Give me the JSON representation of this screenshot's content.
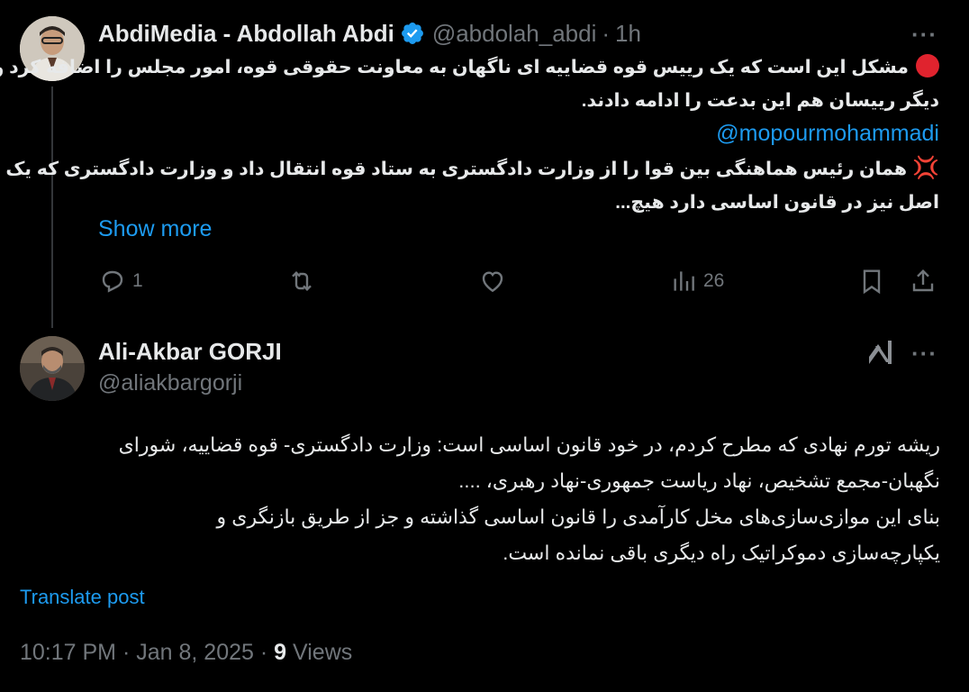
{
  "tweet1": {
    "display_name": "AbdiMedia - Abdollah Abdi",
    "handle": "@abdolah_abdi",
    "separator": "·",
    "time": "1h",
    "more_label": "···",
    "lines": [
      "مشکل این است که یک رییس قوه قضاییه ای ناگهان به معاونت حقوقی قوه، امور مجلس را اضافه کرد و",
      "دیگر رییسان هم این بدعت را ادامه دادند.",
      "همان رئیس هماهنگی بین قوا را از وزارت دادگستری به ستاد قوه انتقال داد و وزارت دادگستری که یک",
      "اصل نیز در قانون اساسی دارد هیچ..."
    ],
    "mention": "@mopourmohammadi",
    "show_more": "Show more",
    "actions": {
      "reply_count": "1",
      "views_count": "26"
    }
  },
  "tweet2": {
    "display_name": "Ali-Akbar GORJI",
    "handle": "@aliakbargorji",
    "more_label": "···",
    "lines": [
      "ریشه تورم نهادی که مطرح کردم، در خود قانون اساسی است: وزارت دادگستری- قوه قضاییه، شورای",
      "نگهبان-مجمع تشخیص، نهاد ریاست جمهوری-نهاد رهبری، ....",
      "بنای این موازی‌سازی‌های مخل کارآمدی را قانون اساسی گذاشته و جز از طریق بازنگری و",
      "یکپارچه‌سازی دموکراتیک راه دیگری باقی نمانده است."
    ],
    "translate": "Translate post",
    "time": "10:17 PM",
    "date": "Jan 8, 2025",
    "separator": "·",
    "views_count": "9",
    "views_label": "Views"
  },
  "colors": {
    "background": "#000000",
    "text": "#e7e9ea",
    "muted": "#71767b",
    "link": "#1d9bf0",
    "verified": "#1d9bf0"
  }
}
